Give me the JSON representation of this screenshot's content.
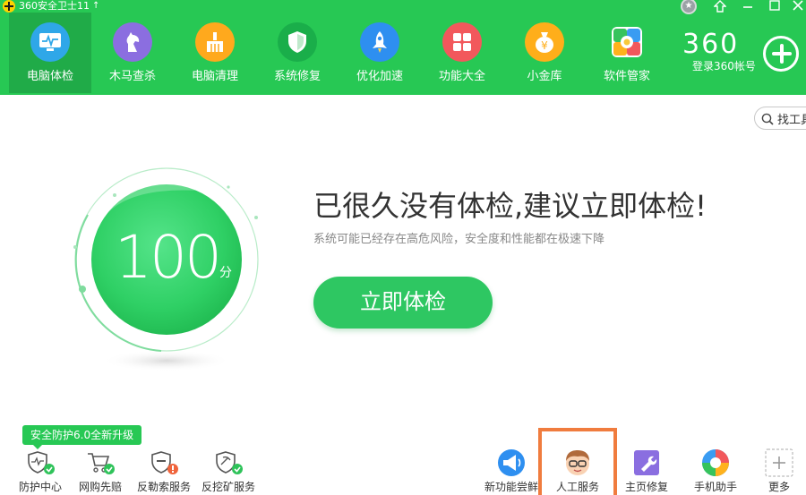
{
  "window": {
    "title": "360安全卫士11",
    "update_arrow": "↑",
    "controls": [
      "skin",
      "pin-top",
      "minimize",
      "maximize",
      "close"
    ]
  },
  "nav": {
    "items": [
      {
        "label": "电脑体检",
        "icon": "monitor-health-icon",
        "color": "#2fa7e8",
        "active": true
      },
      {
        "label": "木马查杀",
        "icon": "horse-icon",
        "color": "#8b6ee0",
        "active": false
      },
      {
        "label": "电脑清理",
        "icon": "broom-icon",
        "color": "#ffa91d",
        "active": false
      },
      {
        "label": "系统修复",
        "icon": "shield-icon",
        "color": "#1aae4a",
        "active": false
      },
      {
        "label": "优化加速",
        "icon": "rocket-icon",
        "color": "#2e8ff0",
        "active": false
      },
      {
        "label": "功能大全",
        "icon": "grid-icon",
        "color": "#f2585c",
        "active": false
      },
      {
        "label": "小金库",
        "icon": "money-bag-icon",
        "color": "#ffae1a",
        "active": false
      },
      {
        "label": "软件管家",
        "icon": "software-manager-icon",
        "color": "#f5f5f5",
        "active": false
      }
    ]
  },
  "account": {
    "brand": "360",
    "login_label": "登录360帐号"
  },
  "search": {
    "label": "找工具"
  },
  "score": {
    "value": "100",
    "unit": "分"
  },
  "main": {
    "headline": "已很久没有体检,建议立即体检!",
    "subtext": "系统可能已经存在高危风险，安全度和性能都在极速下降",
    "scan_button": "立即体检"
  },
  "bottom": {
    "upgrade_badge": "安全防护6.0全新升级",
    "left_items": [
      {
        "label": "防护中心",
        "icon": "protection-center-icon"
      },
      {
        "label": "网购先赔",
        "icon": "shopping-cart-icon"
      },
      {
        "label": "反勒索服务",
        "icon": "anti-ransom-icon"
      },
      {
        "label": "反挖矿服务",
        "icon": "anti-mining-icon"
      }
    ],
    "right_items": [
      {
        "label": "新功能尝鲜",
        "icon": "megaphone-icon"
      },
      {
        "label": "人工服务",
        "icon": "customer-service-avatar-icon",
        "highlighted": true
      },
      {
        "label": "主页修复",
        "icon": "homepage-repair-icon"
      },
      {
        "label": "手机助手",
        "icon": "phone-assistant-icon"
      },
      {
        "label": "更多",
        "icon": "more-plus-icon"
      }
    ]
  },
  "colors": {
    "header_green": "#27c854",
    "active_tab": "#20ab48",
    "highlight_border": "#f07c3e"
  }
}
